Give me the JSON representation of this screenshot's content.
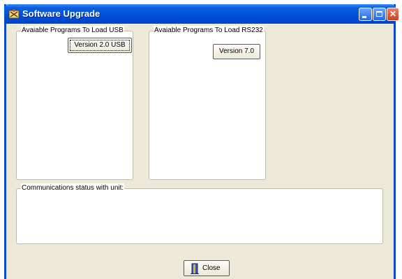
{
  "window": {
    "title": "Software Upgrade"
  },
  "titlebar": {
    "app_icon": "app-icon",
    "buttons": [
      "minimize-icon",
      "maximize-icon",
      "close-icon"
    ],
    "close_glyph": "✕"
  },
  "usb_group": {
    "label": "Avaiable Programs To Load USB",
    "button_label": "Version  2.0 USB"
  },
  "rs232_group": {
    "label": "Avaiable Programs To Load RS232",
    "button_label": "Version  7.0"
  },
  "status_group": {
    "label": "Communications status with unit:"
  },
  "footer": {
    "close_label": "Close",
    "close_icon": "door-icon"
  },
  "colors": {
    "titlebar": "#0050d8",
    "window_border": "#0a4ecc",
    "close_button": "#c8401e",
    "panel": "#ffffff",
    "face": "#ece9d8"
  }
}
